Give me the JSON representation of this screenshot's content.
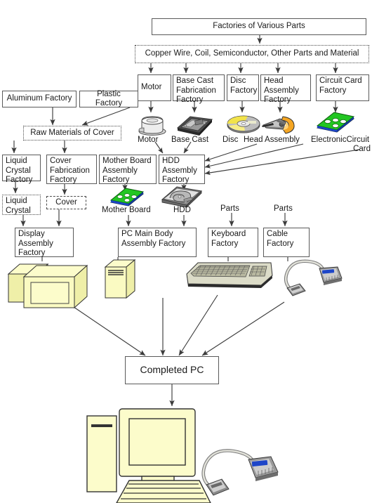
{
  "diagram": {
    "title_box": {
      "label": "Factories of Various Parts"
    },
    "materials_box": {
      "label": "Copper Wire, Coil, Semiconductor, Other Parts and Material"
    },
    "factories_top": [
      {
        "id": "motor-factory",
        "label": "Motor"
      },
      {
        "id": "base-cast-fabrication-factory",
        "label": "Base Cast\nFabrication\nFactory"
      },
      {
        "id": "disc-factory",
        "label": "Disc\nFactory"
      },
      {
        "id": "head-assembly-factory",
        "label": "Head\nAssembly\nFactory"
      },
      {
        "id": "circuit-card-factory",
        "label": "Circuit Card\nFactory"
      }
    ],
    "part_labels": [
      {
        "id": "part-motor",
        "label": "Motor"
      },
      {
        "id": "part-base-cast",
        "label": "Base Cast"
      },
      {
        "id": "part-disc",
        "label": "Disc"
      },
      {
        "id": "part-head-assembly",
        "label": "Head Assembly"
      },
      {
        "id": "part-electronic-circuit-card-line1",
        "label": "ElectronicCircuit"
      },
      {
        "id": "part-electronic-circuit-card-line2",
        "label": "Card"
      }
    ],
    "left_column": {
      "aluminum_factory": {
        "label": "Aluminum Factory"
      },
      "plastic_factory": {
        "label": "Plastic Factory"
      },
      "raw_materials_of_cover": {
        "label": "Raw Materials of Cover"
      },
      "liquid_crystal_factory": {
        "label": "Liquid\nCrystal\nFactory"
      },
      "cover_fabrication_factory": {
        "label": "Cover\nFabrication\nFactory"
      },
      "liquid_crystal": {
        "label": "Liquid\nCrystal"
      },
      "cover": {
        "label": "Cover"
      },
      "display_assembly_factory": {
        "label": "Display\nAssembly\nFactory"
      }
    },
    "mid_column": {
      "mother_board_assembly_factory": {
        "label": "Mother Board\nAssembly\nFactory"
      },
      "hdd_assembly_factory": {
        "label": "HDD\nAssembly\nFactory"
      },
      "mother_board_label": {
        "label": "Mother Board"
      },
      "hdd_label": {
        "label": "HDD"
      },
      "pc_main_body_assembly_factory": {
        "label": "PC Main Body\nAssembly Factory"
      }
    },
    "right_column": {
      "parts_keyboard_label": {
        "label": "Parts"
      },
      "parts_cable_label": {
        "label": "Parts"
      },
      "keyboard_factory": {
        "label": "Keyboard\nFactory"
      },
      "cable_factory": {
        "label": "Cable\nFactory"
      }
    },
    "completed_pc": {
      "label": "Completed PC"
    },
    "icons": [
      {
        "name": "motor-icon"
      },
      {
        "name": "base-cast-icon"
      },
      {
        "name": "disc-icon"
      },
      {
        "name": "head-assembly-icon"
      },
      {
        "name": "circuit-card-icon"
      },
      {
        "name": "mother-board-icon"
      },
      {
        "name": "hdd-icon"
      },
      {
        "name": "crt-monitor-illustration"
      },
      {
        "name": "pc-tower-illustration"
      },
      {
        "name": "keyboard-illustration"
      },
      {
        "name": "cable-connector-illustration"
      },
      {
        "name": "completed-pc-illustration"
      }
    ],
    "colors": {
      "stroke": "#5a5a5a",
      "arrow": "#3c3c3c",
      "text": "#1a1a1a",
      "case_cream": "#FCFCCB",
      "case_cream_dark": "#EFEFA8",
      "pcb_green": "#22C622",
      "pcb_blue": "#1E46C8",
      "disc_yellow": "#F2E34A",
      "metal_gray": "#BFBFBF",
      "head_orange": "#F5A623",
      "keyboard_beige": "#DCDCC8"
    }
  }
}
